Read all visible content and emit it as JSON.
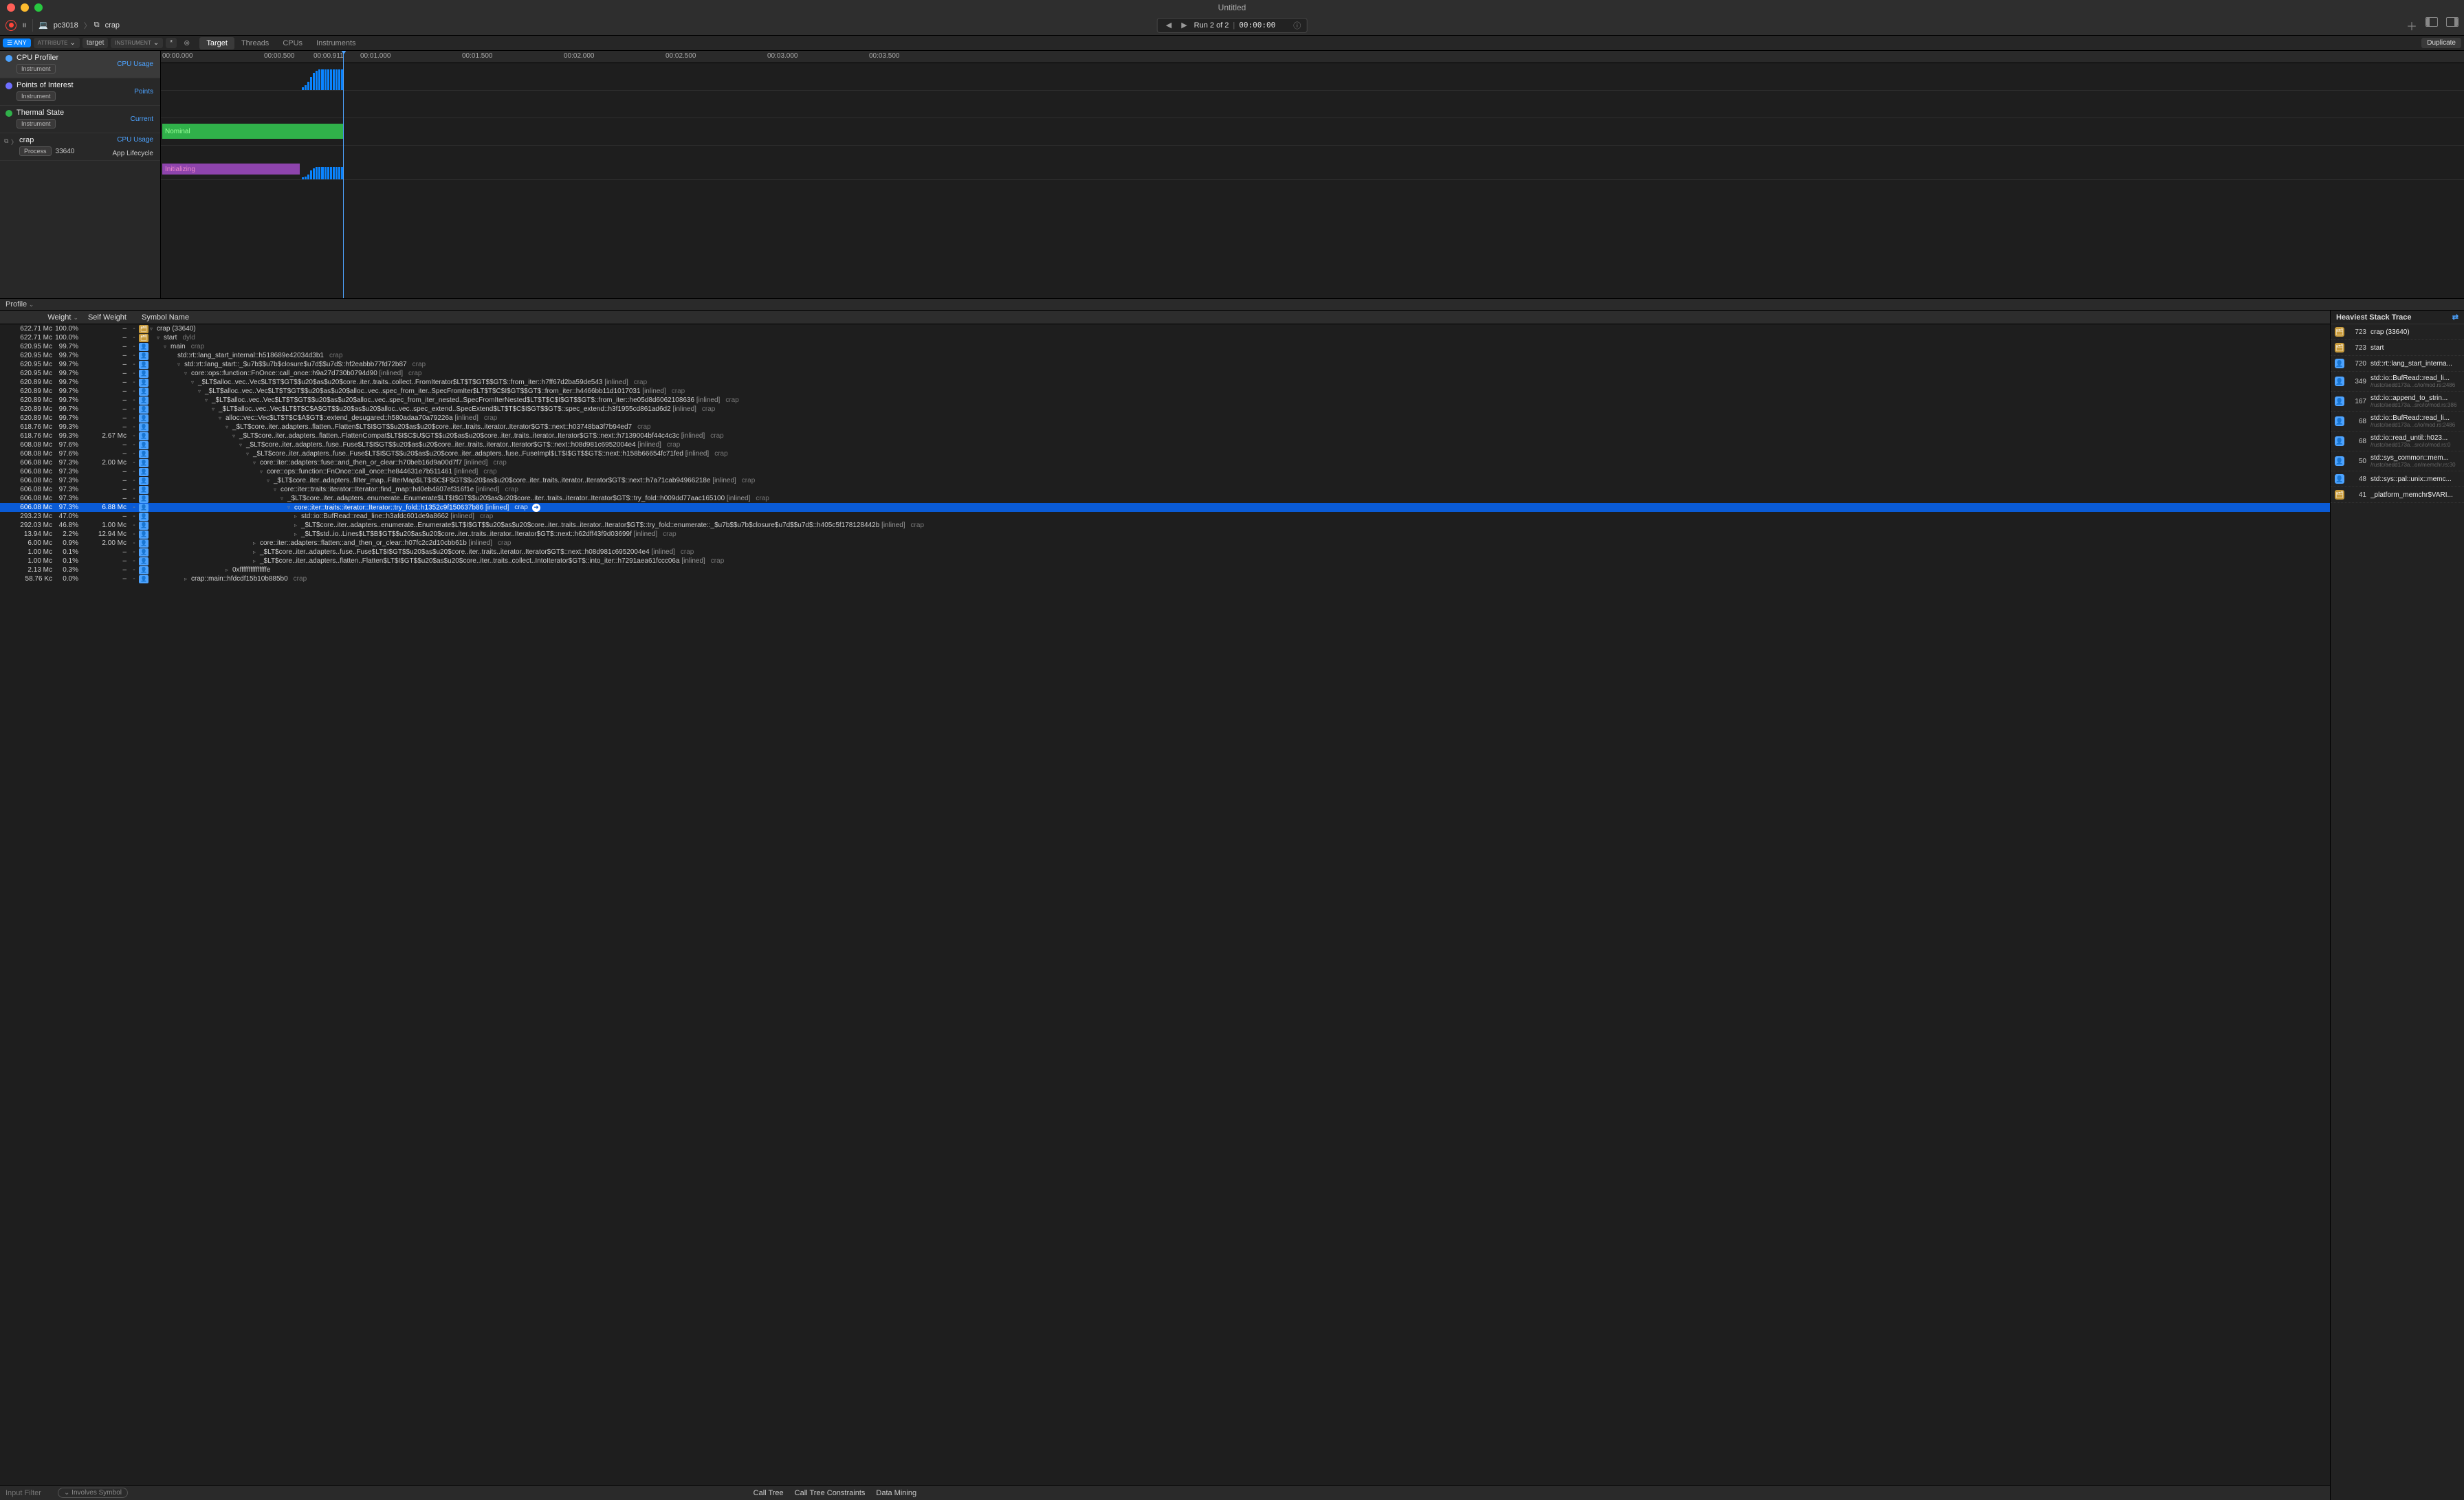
{
  "window": {
    "title": "Untitled"
  },
  "toolbar": {
    "breadcrumb": {
      "host_icon": "💻",
      "host": "pc3018",
      "proc_icon": "⧉",
      "process": "crap"
    },
    "run": {
      "label": "Run 2 of 2",
      "time": "00:00:00"
    },
    "duplicate": "Duplicate"
  },
  "filter": {
    "any": "☰ ANY",
    "attribute": "ATTRIBUTE",
    "target": "target",
    "instrument": "INSTRUMENT",
    "star": "*"
  },
  "tabs": [
    "Target",
    "Threads",
    "CPUs",
    "Instruments"
  ],
  "ruler": [
    "00:00.000",
    "00:00.500",
    "00:00.911",
    "00:01.000",
    "00:01.500",
    "00:02.000",
    "00:02.500",
    "00:03.000",
    "00:03.500"
  ],
  "ruler_pos": [
    2,
    150,
    222,
    290,
    438,
    586,
    734,
    882,
    1030
  ],
  "tracks": [
    {
      "icon_color": "#4da3ff",
      "title": "CPU Profiler",
      "badge": "Instrument",
      "metric": "CPU Usage",
      "selected": true
    },
    {
      "icon_color": "#6e6eff",
      "title": "Points of Interest",
      "badge": "Instrument",
      "metric": "Points"
    },
    {
      "icon_color": "#30b14a",
      "title": "Thermal State",
      "badge": "Instrument",
      "metric": "Current",
      "thermal_label": "Nominal"
    },
    {
      "process": true,
      "title": "crap",
      "badge": "Process",
      "pid": "33640",
      "metric": "CPU Usage",
      "metric2": "App Lifecycle",
      "init_label": "Initializing"
    }
  ],
  "detail_selector": "Profile",
  "columns": {
    "weight": "Weight",
    "self": "Self Weight",
    "symbol": "Symbol Name"
  },
  "rows": [
    {
      "w": "622.71 Mc",
      "p": "100.0%",
      "s": "–",
      "ic": "sys",
      "d": 0,
      "t": "▿",
      "sym": "crap (33640)",
      "lib": ""
    },
    {
      "w": "622.71 Mc",
      "p": "100.0%",
      "s": "–",
      "ic": "sys",
      "d": 1,
      "t": "▿",
      "sym": "start",
      "lib": "dyld"
    },
    {
      "w": "620.95 Mc",
      "p": "99.7%",
      "s": "–",
      "ic": "user",
      "d": 2,
      "t": "▿",
      "sym": "main",
      "lib": "crap"
    },
    {
      "w": "620.95 Mc",
      "p": "99.7%",
      "s": "–",
      "ic": "user",
      "d": 3,
      "t": "",
      "sym": "std::rt::lang_start_internal::h518689e42034d3b1",
      "lib": "crap"
    },
    {
      "w": "620.95 Mc",
      "p": "99.7%",
      "s": "–",
      "ic": "user",
      "d": 4,
      "t": "▿",
      "sym": "std::rt::lang_start::_$u7b$$u7b$closure$u7d$$u7d$::hf2eabbb77fd72b87",
      "lib": "crap"
    },
    {
      "w": "620.95 Mc",
      "p": "99.7%",
      "s": "–",
      "ic": "user",
      "d": 5,
      "t": "▿",
      "sym": "core::ops::function::FnOnce::call_once::h9a27d730b0794d90 [inlined]",
      "lib": "crap"
    },
    {
      "w": "620.89 Mc",
      "p": "99.7%",
      "s": "–",
      "ic": "user",
      "d": 6,
      "t": "▿",
      "sym": "_$LT$alloc..vec..Vec$LT$T$GT$$u20$as$u20$core..iter..traits..collect..FromIterator$LT$T$GT$$GT$::from_iter::h7ff67d2ba59de543 [inlined]",
      "lib": "crap"
    },
    {
      "w": "620.89 Mc",
      "p": "99.7%",
      "s": "–",
      "ic": "user",
      "d": 7,
      "t": "▿",
      "sym": "_$LT$alloc..vec..Vec$LT$T$GT$$u20$as$u20$alloc..vec..spec_from_iter..SpecFromIter$LT$T$C$I$GT$$GT$::from_iter::h4466bb11d1017031 [inlined]",
      "lib": "crap"
    },
    {
      "w": "620.89 Mc",
      "p": "99.7%",
      "s": "–",
      "ic": "user",
      "d": 8,
      "t": "▿",
      "sym": "_$LT$alloc..vec..Vec$LT$T$GT$$u20$as$u20$alloc..vec..spec_from_iter_nested..SpecFromIterNested$LT$T$C$I$GT$$GT$::from_iter::he05d8d6062108636 [inlined]",
      "lib": "crap"
    },
    {
      "w": "620.89 Mc",
      "p": "99.7%",
      "s": "–",
      "ic": "user",
      "d": 9,
      "t": "▿",
      "sym": "_$LT$alloc..vec..Vec$LT$T$C$A$GT$$u20$as$u20$alloc..vec..spec_extend..SpecExtend$LT$T$C$I$GT$$GT$::spec_extend::h3f1955cd861ad6d2 [inlined]",
      "lib": "crap"
    },
    {
      "w": "620.89 Mc",
      "p": "99.7%",
      "s": "–",
      "ic": "user",
      "d": 10,
      "t": "▿",
      "sym": "alloc::vec::Vec$LT$T$C$A$GT$::extend_desugared::h580adaa70a79226a [inlined]",
      "lib": "crap"
    },
    {
      "w": "618.76 Mc",
      "p": "99.3%",
      "s": "–",
      "ic": "user",
      "d": 11,
      "t": "▿",
      "sym": "_$LT$core..iter..adapters..flatten..Flatten$LT$I$GT$$u20$as$u20$core..iter..traits..iterator..Iterator$GT$::next::h03748ba3f7b94ed7",
      "lib": "crap"
    },
    {
      "w": "618.76 Mc",
      "p": "99.3%",
      "s": "2.67 Mc",
      "ic": "user",
      "d": 12,
      "t": "▿",
      "sym": "_$LT$core..iter..adapters..flatten..FlattenCompat$LT$I$C$U$GT$$u20$as$u20$core..iter..traits..iterator..Iterator$GT$::next::h7139004bf44c4c3c [inlined]",
      "lib": "crap"
    },
    {
      "w": "608.08 Mc",
      "p": "97.6%",
      "s": "–",
      "ic": "user",
      "d": 13,
      "t": "▿",
      "sym": "_$LT$core..iter..adapters..fuse..Fuse$LT$I$GT$$u20$as$u20$core..iter..traits..iterator..Iterator$GT$::next::h08d981c6952004e4 [inlined]",
      "lib": "crap"
    },
    {
      "w": "608.08 Mc",
      "p": "97.6%",
      "s": "–",
      "ic": "user",
      "d": 14,
      "t": "▿",
      "sym": "_$LT$core..iter..adapters..fuse..Fuse$LT$I$GT$$u20$as$u20$core..iter..adapters..fuse..FuseImpl$LT$I$GT$$GT$::next::h158b66654fc71fed [inlined]",
      "lib": "crap"
    },
    {
      "w": "606.08 Mc",
      "p": "97.3%",
      "s": "2.00 Mc",
      "ic": "user",
      "d": 15,
      "t": "▿",
      "sym": "core::iter::adapters::fuse::and_then_or_clear::h70beb16d9a00d7f7 [inlined]",
      "lib": "crap"
    },
    {
      "w": "606.08 Mc",
      "p": "97.3%",
      "s": "–",
      "ic": "user",
      "d": 16,
      "t": "▿",
      "sym": "core::ops::function::FnOnce::call_once::he844631e7b511461 [inlined]",
      "lib": "crap"
    },
    {
      "w": "606.08 Mc",
      "p": "97.3%",
      "s": "–",
      "ic": "user",
      "d": 17,
      "t": "▿",
      "sym": "_$LT$core..iter..adapters..filter_map..FilterMap$LT$I$C$F$GT$$u20$as$u20$core..iter..traits..iterator..Iterator$GT$::next::h7a71cab94966218e [inlined]",
      "lib": "crap"
    },
    {
      "w": "606.08 Mc",
      "p": "97.3%",
      "s": "–",
      "ic": "user",
      "d": 18,
      "t": "▿",
      "sym": "core::iter::traits::iterator::Iterator::find_map::hd0eb4607ef316f1e [inlined]",
      "lib": "crap"
    },
    {
      "w": "606.08 Mc",
      "p": "97.3%",
      "s": "–",
      "ic": "user",
      "d": 19,
      "t": "▿",
      "sym": "_$LT$core..iter..adapters..enumerate..Enumerate$LT$I$GT$$u20$as$u20$core..iter..traits..iterator..Iterator$GT$::try_fold::h009dd77aac165100 [inlined]",
      "lib": "crap"
    },
    {
      "w": "606.08 Mc",
      "p": "97.3%",
      "s": "6.88 Mc",
      "ic": "user",
      "d": 20,
      "t": "▿",
      "sym": "core::iter::traits::iterator::Iterator::try_fold::h1352c9f150637b86 [inlined]",
      "lib": "crap",
      "sel": true,
      "goto": true
    },
    {
      "w": "293.23 Mc",
      "p": "47.0%",
      "s": "–",
      "ic": "user",
      "d": 21,
      "t": "▹",
      "sym": "std::io::BufRead::read_line::h3afdc601de9a8662 [inlined]",
      "lib": "crap"
    },
    {
      "w": "292.03 Mc",
      "p": "46.8%",
      "s": "1.00 Mc",
      "ic": "user",
      "d": 21,
      "t": "▹",
      "sym": "_$LT$core..iter..adapters..enumerate..Enumerate$LT$I$GT$$u20$as$u20$core..iter..traits..iterator..Iterator$GT$::try_fold::enumerate::_$u7b$$u7b$closure$u7d$$u7d$::h405c5f178128442b [inlined]",
      "lib": "crap"
    },
    {
      "w": "13.94 Mc",
      "p": "2.2%",
      "s": "12.94 Mc",
      "ic": "user",
      "d": 21,
      "t": "▹",
      "sym": "_$LT$std..io..Lines$LT$B$GT$$u20$as$u20$core..iter..traits..iterator..Iterator$GT$::next::h62dff43f9d03699f [inlined]",
      "lib": "crap"
    },
    {
      "w": "6.00 Mc",
      "p": "0.9%",
      "s": "2.00 Mc",
      "ic": "user",
      "d": 15,
      "t": "▹",
      "sym": "core::iter::adapters::flatten::and_then_or_clear::h07fc2c2d10cbb61b [inlined]",
      "lib": "crap"
    },
    {
      "w": "1.00 Mc",
      "p": "0.1%",
      "s": "–",
      "ic": "user",
      "d": 15,
      "t": "▹",
      "sym": "_$LT$core..iter..adapters..fuse..Fuse$LT$I$GT$$u20$as$u20$core..iter..traits..iterator..Iterator$GT$::next::h08d981c6952004e4 [inlined]",
      "lib": "crap"
    },
    {
      "w": "1.00 Mc",
      "p": "0.1%",
      "s": "–",
      "ic": "user",
      "d": 15,
      "t": "▹",
      "sym": "_$LT$core..iter..adapters..flatten..Flatten$LT$I$GT$$u20$as$u20$core..iter..traits..collect..IntoIterator$GT$::into_iter::h7291aea61fccc06a [inlined]",
      "lib": "crap"
    },
    {
      "w": "2.13 Mc",
      "p": "0.3%",
      "s": "–",
      "ic": "user",
      "d": 11,
      "t": "▹",
      "sym": "0xfffffffffffffffe",
      "lib": ""
    },
    {
      "w": "58.76 Kc",
      "p": "0.0%",
      "s": "–",
      "ic": "user",
      "d": 5,
      "t": "▹",
      "sym": "crap::main::hfdcdf15b10b885b0",
      "lib": "crap"
    }
  ],
  "footer": {
    "filter_placeholder": "Input Filter",
    "involves": "Involves Symbol",
    "options": [
      "Call Tree",
      "Call Tree Constraints",
      "Data Mining"
    ]
  },
  "rpanel": {
    "title": "Heaviest Stack Trace",
    "items": [
      {
        "ic": "sys",
        "cnt": "723",
        "nm": "crap (33640)"
      },
      {
        "ic": "sys",
        "cnt": "723",
        "nm": "start"
      },
      {
        "ic": "user",
        "cnt": "720",
        "nm": "std::rt::lang_start_interna..."
      },
      {
        "ic": "user",
        "cnt": "349",
        "nm": "std::io::BufRead::read_li...",
        "sub": "/rustc/aedd173a...c/io/mod.rs:2486"
      },
      {
        "ic": "user",
        "cnt": "167",
        "nm": "std::io::append_to_strin...",
        "sub": "/rustc/aedd173a...src/io/mod.rs:386"
      },
      {
        "ic": "user",
        "cnt": "68",
        "nm": "std::io::BufRead::read_li...",
        "sub": "/rustc/aedd173a...c/io/mod.rs:2486"
      },
      {
        "ic": "user",
        "cnt": "68",
        "nm": "std::io::read_until::h023...",
        "sub": "/rustc/aedd173a...src/io/mod.rs:0"
      },
      {
        "ic": "user",
        "cnt": "50",
        "nm": "std::sys_common::mem...",
        "sub": "/rustc/aedd173a...on/memchr.rs:30"
      },
      {
        "ic": "user",
        "cnt": "48",
        "nm": "std::sys::pal::unix::memc..."
      },
      {
        "ic": "sys",
        "cnt": "41",
        "nm": "_platform_memchr$VARI..."
      }
    ]
  }
}
